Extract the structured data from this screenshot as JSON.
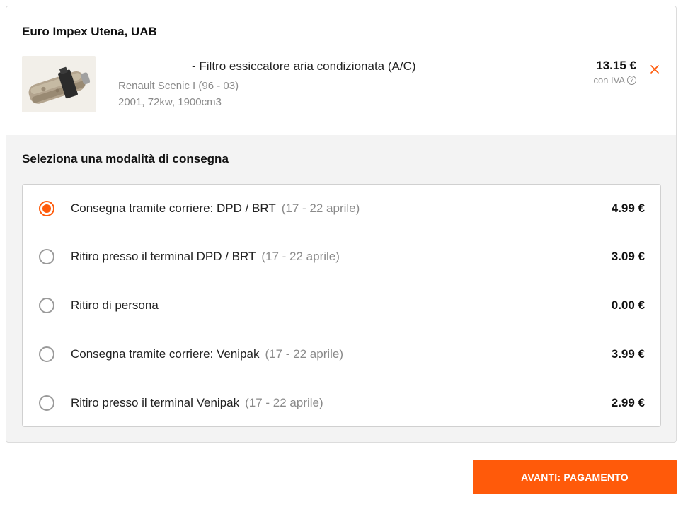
{
  "seller": {
    "name": "Euro Impex Utena, UAB"
  },
  "product": {
    "title": "- Filtro essiccatore aria condizionata (A/C)",
    "car": "Renault Scenic I (96 - 03)",
    "spec": "2001, 72kw, 1900cm3",
    "price": "13.15 €",
    "vat_label": "con IVA",
    "help_glyph": "?",
    "remove_icon": "close-icon",
    "image_icon": "ac-filter-drier-photo"
  },
  "delivery": {
    "title": "Seleziona una modalità di consegna",
    "options": [
      {
        "label": "Consegna tramite corriere: DPD / BRT",
        "dates": "(17 - 22 aprile)",
        "price": "4.99 €",
        "selected": true
      },
      {
        "label": "Ritiro presso il terminal DPD / BRT",
        "dates": "(17 - 22 aprile)",
        "price": "3.09 €",
        "selected": false
      },
      {
        "label": "Ritiro di persona",
        "dates": "",
        "price": "0.00 €",
        "selected": false
      },
      {
        "label": "Consegna tramite corriere: Venipak",
        "dates": "(17 - 22 aprile)",
        "price": "3.99 €",
        "selected": false
      },
      {
        "label": "Ritiro presso il terminal Venipak",
        "dates": "(17 - 22 aprile)",
        "price": "2.99 €",
        "selected": false
      }
    ]
  },
  "actions": {
    "next_label": "AVANTI: PAGAMENTO"
  },
  "colors": {
    "accent": "#ff5a0a",
    "muted": "#8a8a8a",
    "border": "#d0d0d0",
    "panel": "#f3f3f3"
  }
}
